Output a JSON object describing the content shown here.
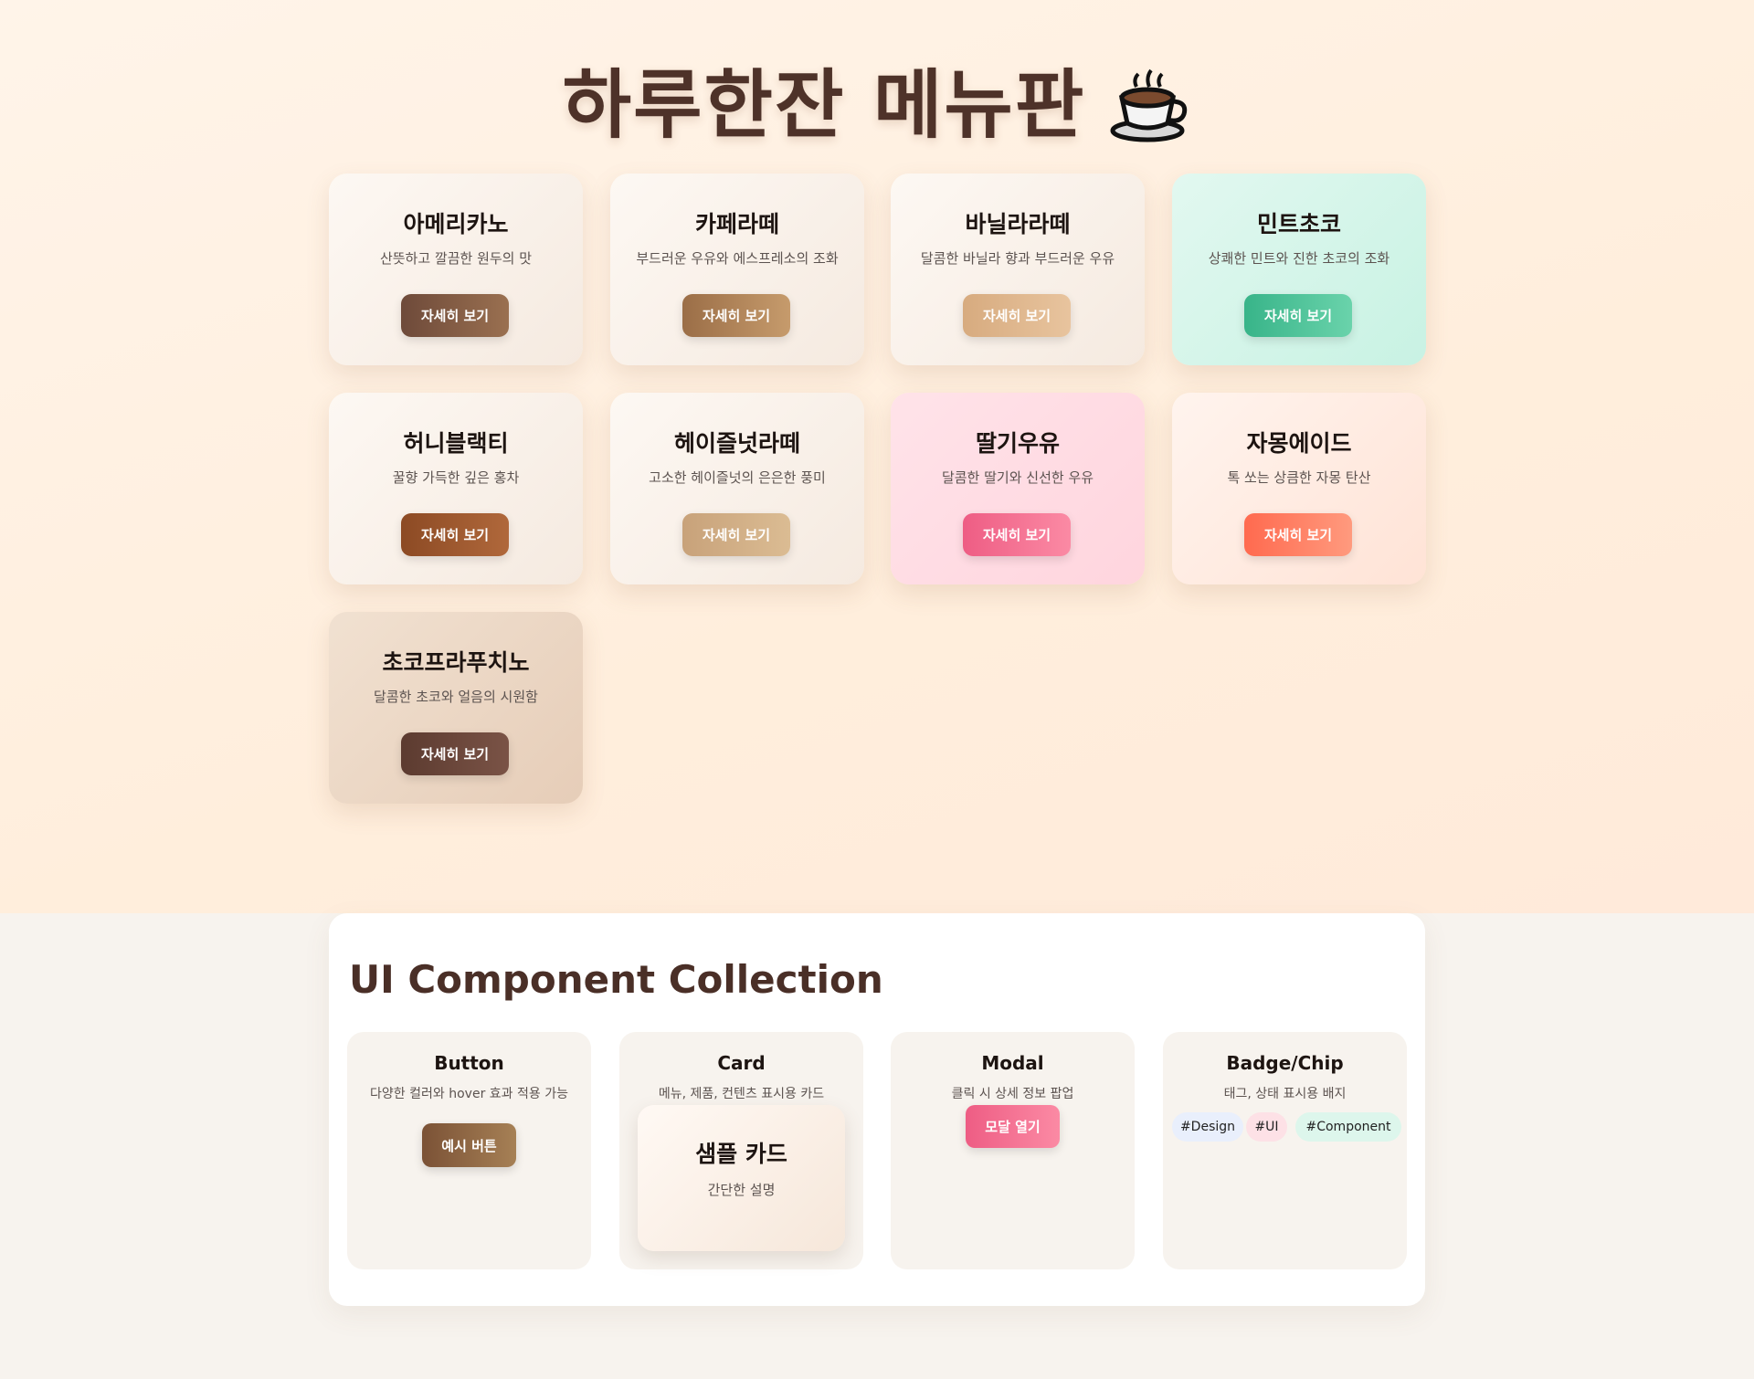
{
  "hero": {
    "title": "하루한잔 메뉴판",
    "icon": "coffee-cup-icon"
  },
  "menu": {
    "button_label": "자세히 보기",
    "items": [
      {
        "name": "아메리카노",
        "desc": "산뜻하고 깔끔한 원두의 맛",
        "accent": "#6e4a3a"
      },
      {
        "name": "카페라떼",
        "desc": "부드러운 우유와 에스프레소의 조화",
        "accent": "#9b6e47"
      },
      {
        "name": "바닐라라떼",
        "desc": "달콤한 바닐라 향과 부드러운 우유",
        "accent": "#d7ab7f"
      },
      {
        "name": "민트초코",
        "desc": "상쾌한 민트와 진한 초코의 조화",
        "accent": "#38b489"
      },
      {
        "name": "허니블랙티",
        "desc": "꿀향 가득한 깊은 홍차",
        "accent": "#8c4a24"
      },
      {
        "name": "헤이즐넛라떼",
        "desc": "고소한 헤이즐넛의 은은한 풍미",
        "accent": "#c8a27a"
      },
      {
        "name": "딸기우유",
        "desc": "달콤한 딸기와 신선한 우유",
        "accent": "#ee5d84"
      },
      {
        "name": "자몽에이드",
        "desc": "톡 쏘는 상큼한 자몽 탄산",
        "accent": "#ff6a4f"
      },
      {
        "name": "초코프라푸치노",
        "desc": "달콤한 초코와 얼음의 시원함",
        "accent": "#5c3b30"
      }
    ]
  },
  "collection": {
    "title": "UI Component Collection",
    "button": {
      "title": "Button",
      "desc": "다양한 컬러와 hover 효과 적용 가능",
      "example_label": "예시 버튼"
    },
    "card": {
      "title": "Card",
      "desc": "메뉴, 제품, 컨텐츠 표시용 카드",
      "sample_title": "샘플 카드",
      "sample_desc": "간단한 설명"
    },
    "modal": {
      "title": "Modal",
      "desc": "클릭 시 상세 정보 팝업",
      "open_label": "모달 열기"
    },
    "badge": {
      "title": "Badge/Chip",
      "desc": "태그, 상태 표시용 배지",
      "chips": [
        "#Design",
        "#UI",
        "#Component"
      ]
    }
  }
}
